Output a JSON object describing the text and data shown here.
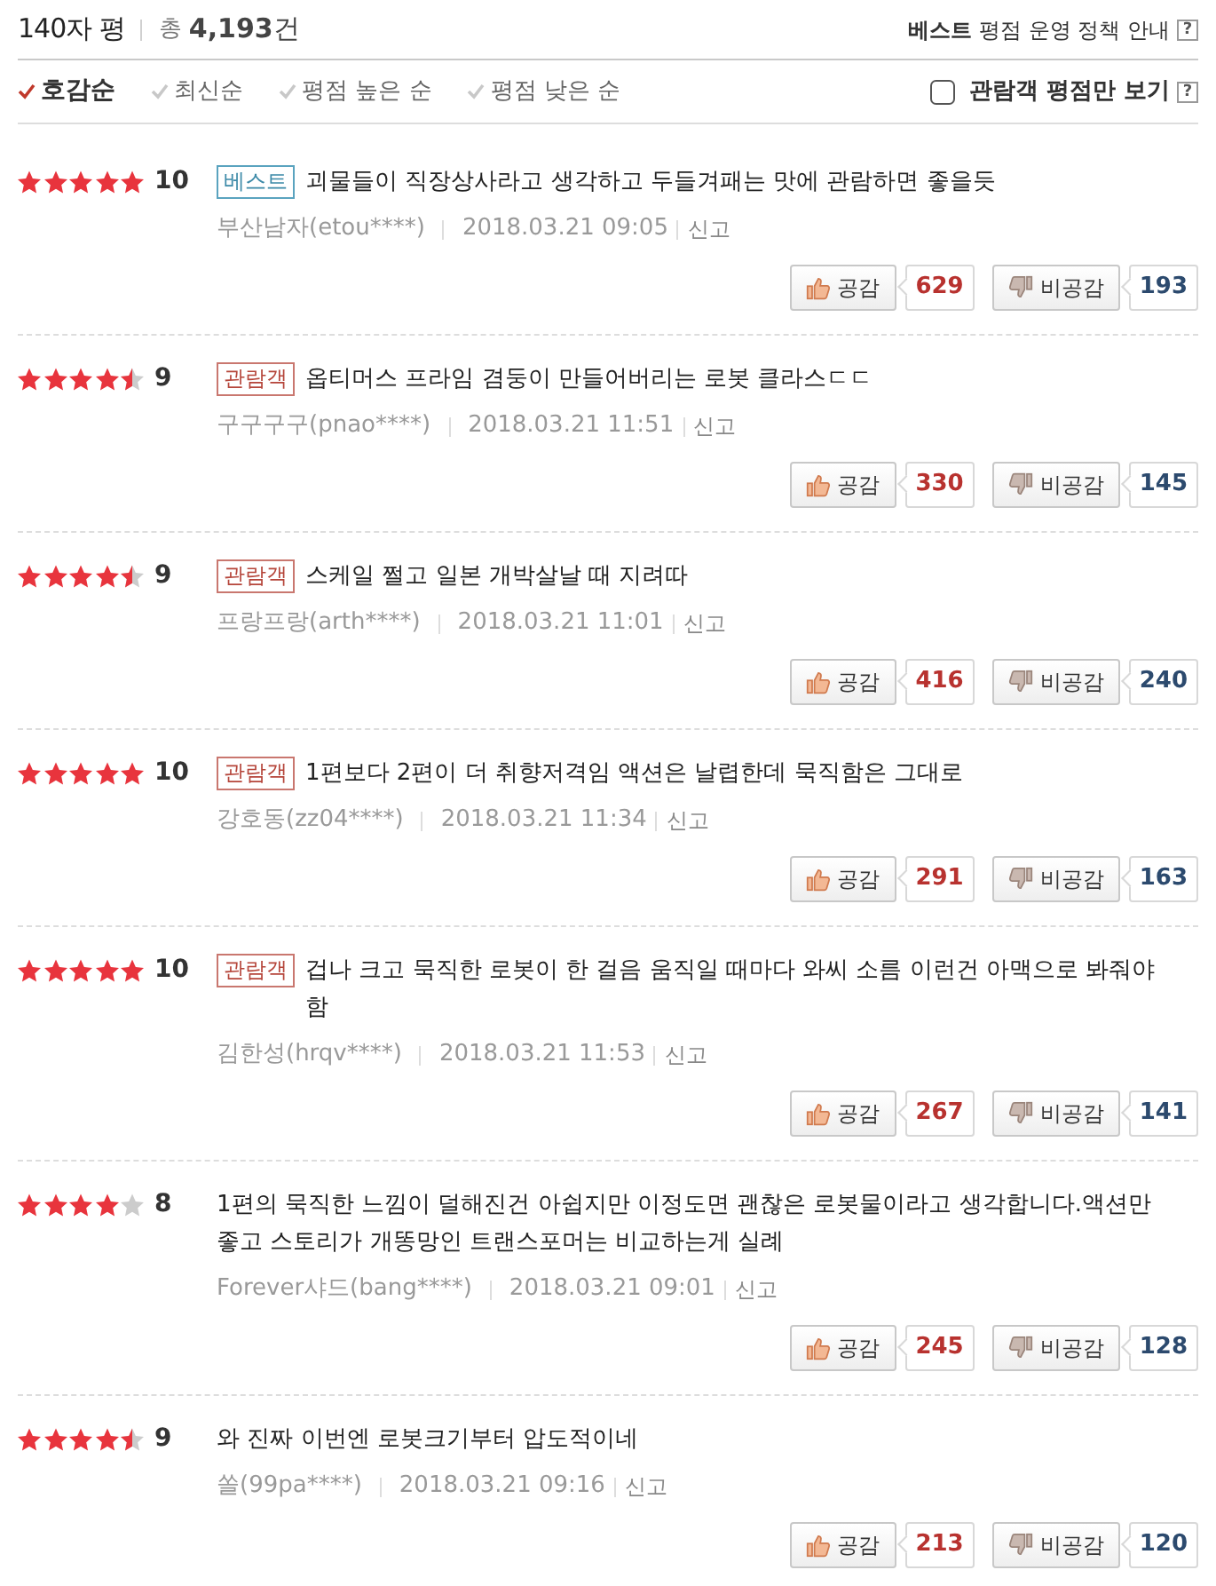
{
  "header": {
    "title": "140자 평",
    "total_label": "총",
    "total_count": "**4,193**건",
    "policy_link": "**베스트** 평점 운영 정책 안내",
    "help": "?"
  },
  "sort_options": [
    {
      "label": "호감순",
      "selected": true
    },
    {
      "label": "최신순",
      "selected": false
    },
    {
      "label": "평점 높은 순",
      "selected": false
    },
    {
      "label": "평점 낮은 순",
      "selected": false
    }
  ],
  "viewer_filter": {
    "label": "관람객 평점만 보기",
    "checked": false,
    "help": "?"
  },
  "reviews": [
    {
      "stars": 5,
      "score": "10",
      "badge": {
        "kind": "best",
        "text": "베스트"
      },
      "text": "괴물들이 직장상사라고 생각하고 두들겨패는 맛에 관람하면 좋을듯",
      "author": "부산남자(etou****)",
      "date": "2018.03.21 09:05",
      "report": "신고",
      "like_label": "공감",
      "likes": "629",
      "dislike_label": "비공감",
      "dislikes": "193"
    },
    {
      "stars": 4.5,
      "score": "9",
      "badge": {
        "kind": "viewer",
        "text": "관람객"
      },
      "text": "옵티머스 프라임 겸둥이 만들어버리는 로봇 클라스ㄷㄷ",
      "author": "구구구구(pnao****)",
      "date": "2018.03.21 11:51",
      "report": "신고",
      "like_label": "공감",
      "likes": "330",
      "dislike_label": "비공감",
      "dislikes": "145"
    },
    {
      "stars": 4.5,
      "score": "9",
      "badge": {
        "kind": "viewer",
        "text": "관람객"
      },
      "text": "스케일 쩔고 일본 개박살날 때 지려따",
      "author": "프랑프랑(arth****)",
      "date": "2018.03.21 11:01",
      "report": "신고",
      "like_label": "공감",
      "likes": "416",
      "dislike_label": "비공감",
      "dislikes": "240"
    },
    {
      "stars": 5,
      "score": "10",
      "badge": {
        "kind": "viewer",
        "text": "관람객"
      },
      "text": "1편보다 2편이 더 취향저격임 액션은 날렵한데 묵직함은 그대로",
      "author": "강호동(zz04****)",
      "date": "2018.03.21 11:34",
      "report": "신고",
      "like_label": "공감",
      "likes": "291",
      "dislike_label": "비공감",
      "dislikes": "163"
    },
    {
      "stars": 5,
      "score": "10",
      "badge": {
        "kind": "viewer",
        "text": "관람객"
      },
      "text": "겁나 크고 묵직한 로봇이 한 걸음 움직일 때마다 와씨 소름 이런건 아맥으로 봐줘야 함",
      "author": "김한성(hrqv****)",
      "date": "2018.03.21 11:53",
      "report": "신고",
      "like_label": "공감",
      "likes": "267",
      "dislike_label": "비공감",
      "dislikes": "141"
    },
    {
      "stars": 4,
      "score": "8",
      "text": "1편의 묵직한 느낌이 덜해진건 아쉽지만 이정도면 괜찮은 로봇물이라고 생각합니다.액션만 좋고 스토리가 개똥망인 트랜스포머는 비교하는게 실례",
      "author": "Forever샤드(bang****)",
      "date": "2018.03.21 09:01",
      "report": "신고",
      "like_label": "공감",
      "likes": "245",
      "dislike_label": "비공감",
      "dislikes": "128"
    },
    {
      "stars": 4.5,
      "score": "9",
      "text": "와 진짜 이번엔 로봇크기부터 압도적이네",
      "author": "쏠(99pa****)",
      "date": "2018.03.21 09:16",
      "report": "신고",
      "like_label": "공감",
      "likes": "213",
      "dislike_label": "비공감",
      "dislikes": "120"
    }
  ]
}
